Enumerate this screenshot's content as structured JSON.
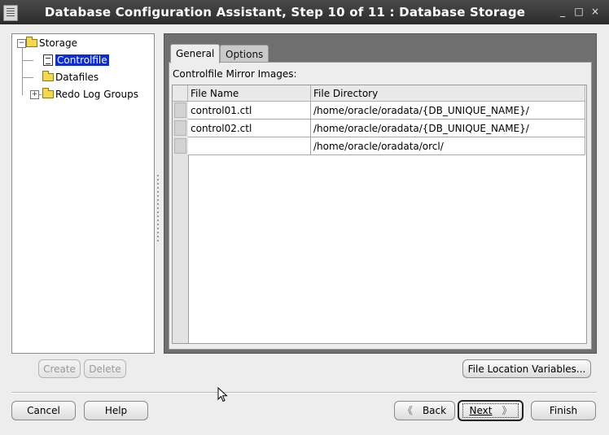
{
  "window": {
    "title": "Database Configuration Assistant, Step 10 of 11 : Database Storage",
    "minimize_glyph": "_",
    "maximize_glyph": "□",
    "close_glyph": "×"
  },
  "tree": {
    "root": {
      "label": "Storage",
      "icon": "folder-icon",
      "expanded": true
    },
    "items": [
      {
        "label": "Controlfile",
        "icon": "controlfile-icon",
        "selected": true
      },
      {
        "label": "Datafiles",
        "icon": "folder-icon",
        "selected": false
      },
      {
        "label": "Redo Log Groups",
        "icon": "folder-icon",
        "selected": false,
        "expandable": true
      }
    ]
  },
  "tabs": [
    {
      "label": "General",
      "active": true
    },
    {
      "label": "Options",
      "active": false
    }
  ],
  "general": {
    "mirror_label": "Controlfile Mirror Images:",
    "columns": [
      "File Name",
      "File Directory"
    ],
    "rows": [
      {
        "file_name": "control01.ctl",
        "file_directory": "/home/oracle/oradata/{DB_UNIQUE_NAME}/"
      },
      {
        "file_name": "control02.ctl",
        "file_directory": "/home/oracle/oradata/{DB_UNIQUE_NAME}/"
      },
      {
        "file_name": "",
        "file_directory": "/home/oracle/oradata/orcl/"
      }
    ]
  },
  "buttons": {
    "create": "Create",
    "delete": "Delete",
    "file_location_variables": "File Location Variables...",
    "cancel": "Cancel",
    "help": "Help",
    "back": "Back",
    "next": "Next",
    "finish": "Finish"
  },
  "colors": {
    "selection": "#0c2cd6",
    "titlebar": "#2b2b2b",
    "tab_frame": "#6f6f6f"
  }
}
